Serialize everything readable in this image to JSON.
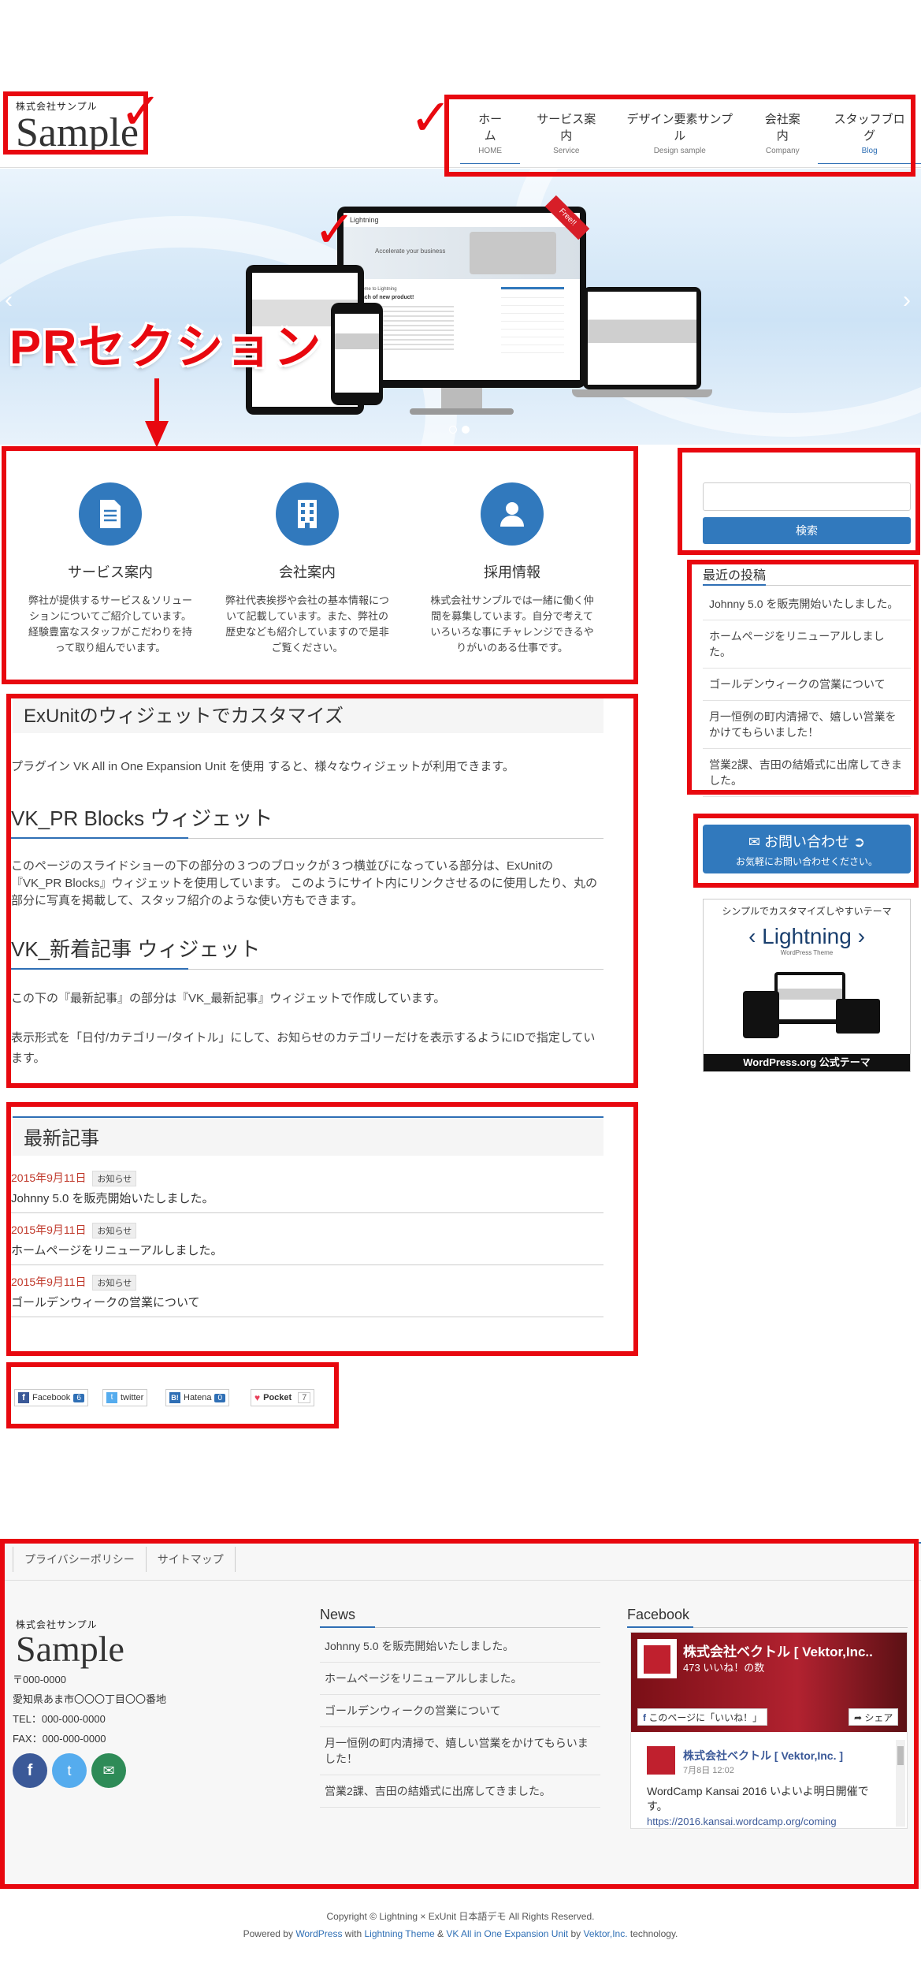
{
  "header": {
    "logo_small": "株式会社サンプル",
    "logo_big": "Sample",
    "nav": [
      {
        "ja": "ホーム",
        "en": "HOME"
      },
      {
        "ja": "サービス案内",
        "en": "Service"
      },
      {
        "ja": "デザイン要素サンプル",
        "en": "Design sample"
      },
      {
        "ja": "会社案内",
        "en": "Company"
      },
      {
        "ja": "スタッフブログ",
        "en": "Blog"
      }
    ]
  },
  "hero": {
    "device_title": "Lightning",
    "device_tagline": "Accelerate your business",
    "ribbon": "Free!!",
    "card_heading": "Welcome to Lightning",
    "card_title": "Launch of new product!",
    "dots": 2
  },
  "annotation": {
    "pr_label": "PRセクション"
  },
  "pr_blocks": [
    {
      "icon": "document-icon",
      "title": "サービス案内",
      "text": "弊社が提供するサービス＆ソリューションについてご紹介しています。経験豊富なスタッフがこだわりを持って取り組んでいます。"
    },
    {
      "icon": "building-icon",
      "title": "会社案内",
      "text": "弊社代表挨拶や会社の基本情報について記載しています。また、弊社の歴史なども紹介していますので是非ご覧ください。"
    },
    {
      "icon": "person-icon",
      "title": "採用情報",
      "text": "株式会社サンプルでは一緒に働く仲間を募集しています。自分で考えていろいろな事にチャレンジできるやりがいのある仕事です。"
    }
  ],
  "content": {
    "widget_heading": "ExUnitのウィジェットでカスタマイズ",
    "widget_intro": "プラグイン VK All in One Expansion Unit を使用 すると、様々なウィジェットが利用できます。",
    "pr_blocks_heading": "VK_PR Blocks ウィジェット",
    "pr_blocks_text": "このページのスライドショーの下の部分の３つのブロックが３つ横並びになっている部分は、ExUnitの『VK_PR Blocks』ウィジェットを使用しています。 このようにサイト内にリンクさせるのに使用したり、丸の部分に写真を掲載して、スタッフ紹介のような使い方もできます。",
    "new_posts_heading": "VK_新着記事 ウィジェット",
    "new_posts_text1": "この下の『最新記事』の部分は『VK_最新記事』ウィジェットで作成しています。",
    "new_posts_text2": "表示形式を「日付/カテゴリー/タイトル」にして、お知らせのカテゴリーだけを表示するようにIDで指定しています。"
  },
  "latest": {
    "heading": "最新記事",
    "items": [
      {
        "date": "2015年9月11日",
        "cat": "お知らせ",
        "title": "Johnny 5.0 を販売開始いたしました。"
      },
      {
        "date": "2015年9月11日",
        "cat": "お知らせ",
        "title": "ホームページをリニューアルしました。"
      },
      {
        "date": "2015年9月11日",
        "cat": "お知らせ",
        "title": "ゴールデンウィークの営業について"
      }
    ]
  },
  "share": {
    "facebook": "Facebook",
    "facebook_count": "6",
    "twitter": "twitter",
    "hatena": "Hatena",
    "hatena_count": "0",
    "pocket": "Pocket",
    "pocket_count": "7"
  },
  "sidebar": {
    "search_placeholder": "",
    "search_button": "検索",
    "recent_heading": "最近の投稿",
    "recent": [
      "Johnny 5.0 を販売開始いたしました。",
      "ホームページをリニューアルしました。",
      "ゴールデンウィークの営業について",
      "月一恒例の町内清掃で、嬉しい営業をかけてもらいました！",
      "営業2課、吉田の結婚式に出席してきました。"
    ],
    "contact_main": "お問い合わせ",
    "contact_sub": "お気軽にお問い合わせください。",
    "banner_top": "シンプルでカスタマイズしやすいテーマ",
    "banner_logo": "Lightning",
    "banner_logo_sub": "WordPress Theme",
    "banner_bottom": "WordPress.org 公式テーマ"
  },
  "footer": {
    "links": [
      "プライバシーポリシー",
      "サイトマップ"
    ],
    "logo_small": "株式会社サンプル",
    "logo_big": "Sample",
    "address": [
      "〒000-0000",
      "愛知県あま市〇〇〇丁目〇〇番地",
      "TEL：000-000-0000",
      "FAX：000-000-0000"
    ],
    "news_heading": "News",
    "news": [
      "Johnny 5.0 を販売開始いたしました。",
      "ホームページをリニューアルしました。",
      "ゴールデンウィークの営業について",
      "月一恒例の町内清掃で、嬉しい営業をかけてもらいました！",
      "営業2課、吉田の結婚式に出席してきました。"
    ],
    "fb_heading": "Facebook",
    "fb_page": "株式会社ベクトル [ Vektor,Inc..",
    "fb_likes": "473 いいね！の数",
    "fb_like_btn": "このページに「いいね！」",
    "fb_share_btn": "シェア",
    "fb_post_author": "株式会社ベクトル [ Vektor,Inc. ]",
    "fb_post_date": "7月8日 12:02",
    "fb_post_text": "WordCamp Kansai 2016 いよいよ明日開催です。",
    "fb_post_link": "https://2016.kansai.wordcamp.org/coming",
    "copyright": "Copyright © Lightning × ExUnit 日本語デモ All Rights Reserved.",
    "powered_pre": "Powered by",
    "powered_wp": "WordPress",
    "powered_with": "with",
    "powered_theme": "Lightning Theme",
    "powered_amp": "&",
    "powered_exunit": "VK All in One Expansion Unit",
    "powered_by": "by",
    "powered_vektor": "Vektor,Inc.",
    "powered_post": "technology."
  },
  "colors": {
    "accent": "#3179bd",
    "annotation": "#e8080f",
    "date": "#c0392b"
  }
}
